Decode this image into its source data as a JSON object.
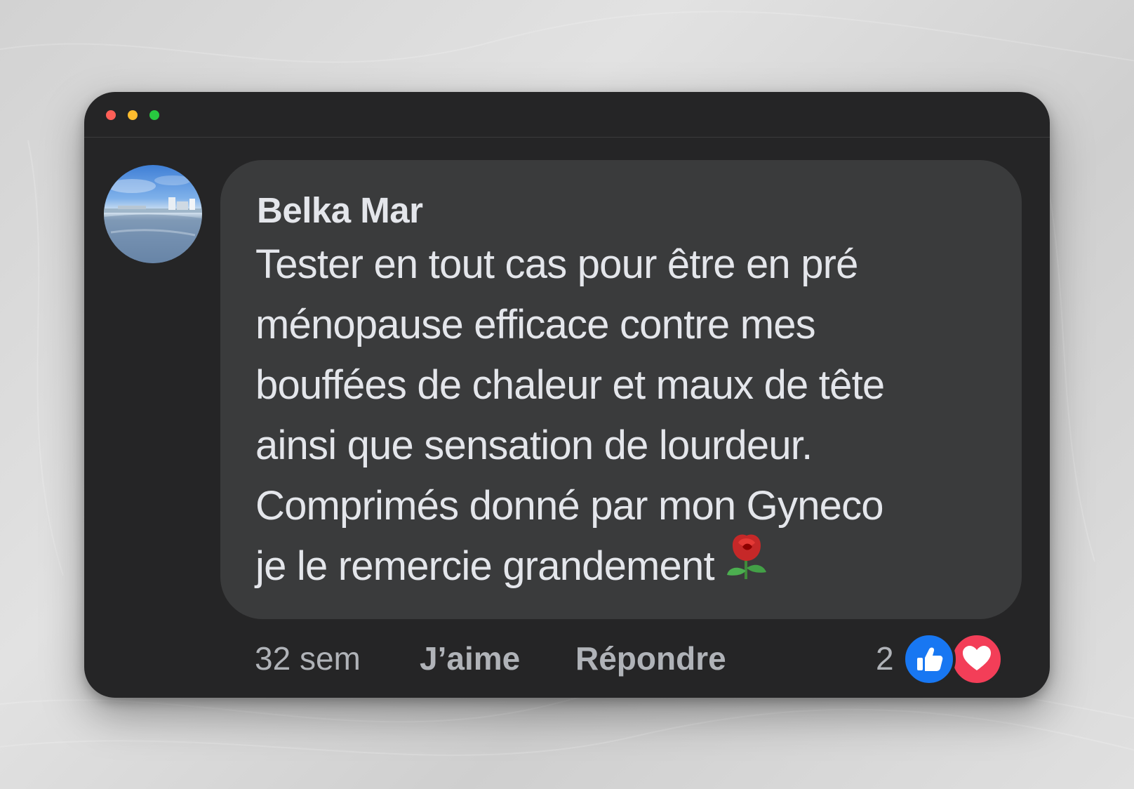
{
  "window": {
    "controls": [
      "close",
      "minimize",
      "zoom"
    ]
  },
  "comment": {
    "author": "Belka Mar",
    "avatar_icon": "avatar-landscape-photo",
    "text_lines": [
      "Tester en tout cas pour être en pré",
      "ménopause efficace contre mes",
      "bouffées de chaleur et maux de tête",
      "ainsi que sensation de lourdeur.",
      "Comprimés donné par mon Gyneco",
      "je le remercie grandement"
    ],
    "trailing_emoji": "rose-icon"
  },
  "actions": {
    "time": "32 sem",
    "like_label": "J’aime",
    "reply_label": "Répondre"
  },
  "reactions": {
    "count": "2",
    "types": [
      "like-icon",
      "love-icon"
    ],
    "colors": {
      "like": "#1877f2",
      "love": "#f33e58"
    }
  },
  "colors": {
    "window_bg": "#252526",
    "bubble_bg": "#3a3b3c",
    "text": "#e4e6eb",
    "muted": "#b0b3b8"
  }
}
